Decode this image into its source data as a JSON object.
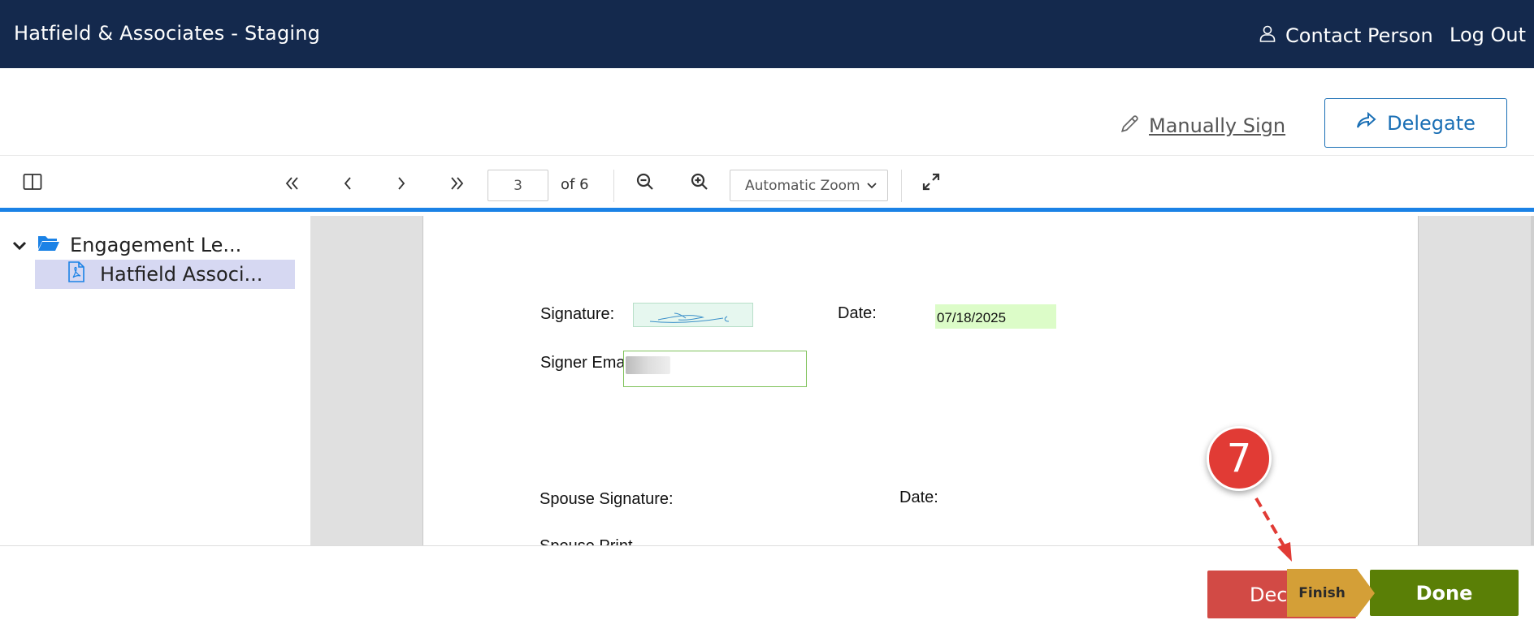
{
  "header": {
    "app_title": "Hatfield & Associates - Staging",
    "user_label": "Contact Person",
    "logout_label": "Log Out"
  },
  "actions": {
    "manual_sign_label": "Manually Sign",
    "delegate_label": "Delegate"
  },
  "toolbar": {
    "current_page": "3",
    "page_total_label": "of 6",
    "zoom_label": "Automatic Zoom"
  },
  "sidebar": {
    "folder_label": "Engagement Le...",
    "file_label": "Hatfield Associ..."
  },
  "document": {
    "signature_label": "Signature:",
    "date_label": "Date:",
    "date_value": "07/18/2025",
    "signer_email_label": "Signer Email:",
    "spouse_signature_label": "Spouse Signature:",
    "spouse_date_label": "Date:",
    "spouse_print_label": "Spouse Print"
  },
  "footer": {
    "decline_label": "Decl",
    "done_label": "Done"
  },
  "overlay": {
    "step_number": "7",
    "callout_label": "Finish"
  },
  "colors": {
    "header_bg": "#14294d",
    "accent_blue": "#1b82e6",
    "decline_red": "#d24a45",
    "done_green": "#5a7f06",
    "callout_gold": "#d49f37",
    "badge_red": "#e13b35"
  }
}
